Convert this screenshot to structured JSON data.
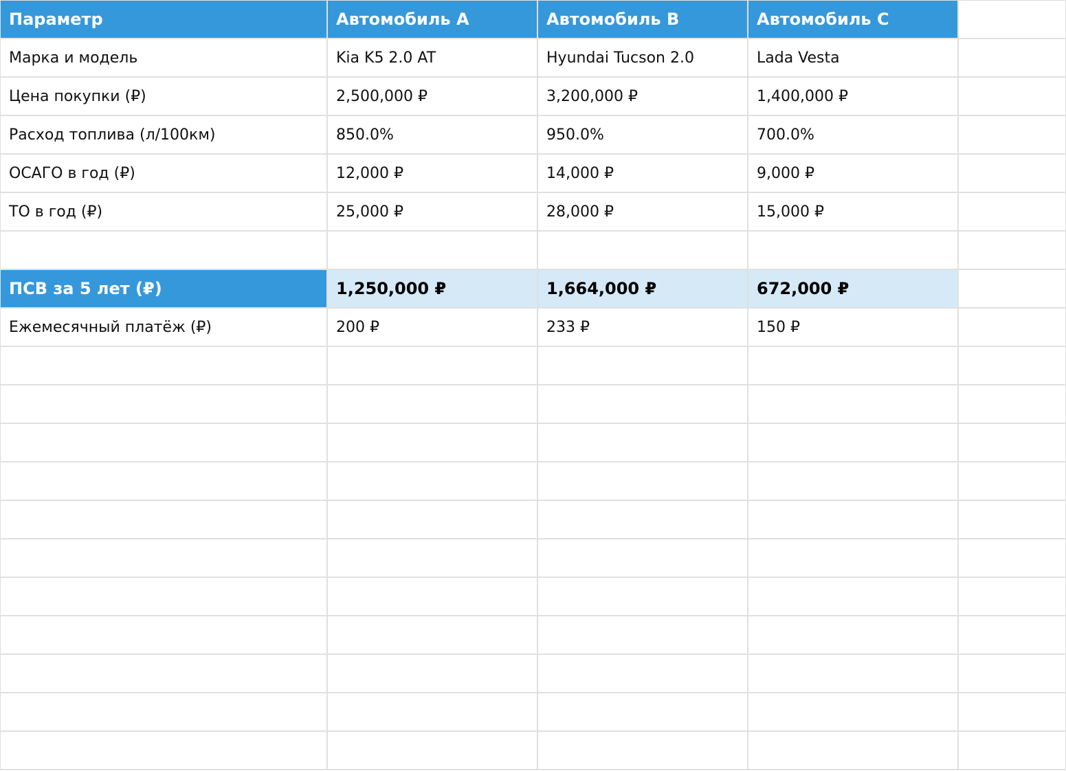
{
  "header": [
    "Параметр",
    "Автомобиль A",
    "Автомобиль B",
    "Автомобиль C",
    ""
  ],
  "rows": [
    {
      "type": "normal",
      "cells": [
        "Марка и модель",
        "Kia K5 2.0 AT",
        "Hyundai Tucson 2.0",
        "Lada Vesta",
        ""
      ]
    },
    {
      "type": "normal",
      "cells": [
        "Цена покупки (₽)",
        "2,500,000 ₽",
        "3,200,000 ₽",
        "1,400,000 ₽",
        ""
      ]
    },
    {
      "type": "normal",
      "cells": [
        "Расход топлива (л/100км)",
        "850.0%",
        "950.0%",
        "700.0%",
        ""
      ]
    },
    {
      "type": "normal",
      "cells": [
        "ОСАГО в год (₽)",
        "12,000 ₽",
        "14,000 ₽",
        "9,000 ₽",
        ""
      ]
    },
    {
      "type": "normal",
      "cells": [
        "ТО в год (₽)",
        "25,000 ₽",
        "28,000 ₽",
        "15,000 ₽",
        ""
      ]
    },
    {
      "type": "normal",
      "cells": [
        "",
        "",
        "",
        "",
        ""
      ]
    },
    {
      "type": "total",
      "cells": [
        "ПСВ за 5 лет (₽)",
        "1,250,000 ₽",
        "1,664,000 ₽",
        "672,000 ₽",
        ""
      ]
    },
    {
      "type": "normal",
      "cells": [
        "Ежемесячный платёж (₽)",
        "200 ₽",
        "233 ₽",
        "150 ₽",
        ""
      ]
    },
    {
      "type": "normal",
      "cells": [
        "",
        "",
        "",
        "",
        ""
      ]
    },
    {
      "type": "normal",
      "cells": [
        "",
        "",
        "",
        "",
        ""
      ]
    },
    {
      "type": "normal",
      "cells": [
        "",
        "",
        "",
        "",
        ""
      ]
    },
    {
      "type": "normal",
      "cells": [
        "",
        "",
        "",
        "",
        ""
      ]
    },
    {
      "type": "normal",
      "cells": [
        "",
        "",
        "",
        "",
        ""
      ]
    },
    {
      "type": "normal",
      "cells": [
        "",
        "",
        "",
        "",
        ""
      ]
    },
    {
      "type": "normal",
      "cells": [
        "",
        "",
        "",
        "",
        ""
      ]
    },
    {
      "type": "normal",
      "cells": [
        "",
        "",
        "",
        "",
        ""
      ]
    },
    {
      "type": "normal",
      "cells": [
        "",
        "",
        "",
        "",
        ""
      ]
    },
    {
      "type": "normal",
      "cells": [
        "",
        "",
        "",
        "",
        ""
      ]
    },
    {
      "type": "normal",
      "cells": [
        "",
        "",
        "",
        "",
        ""
      ]
    }
  ],
  "colors": {
    "header": "#3598db",
    "highlight": "#d6e9f7",
    "grid": "#e0e0e0"
  }
}
